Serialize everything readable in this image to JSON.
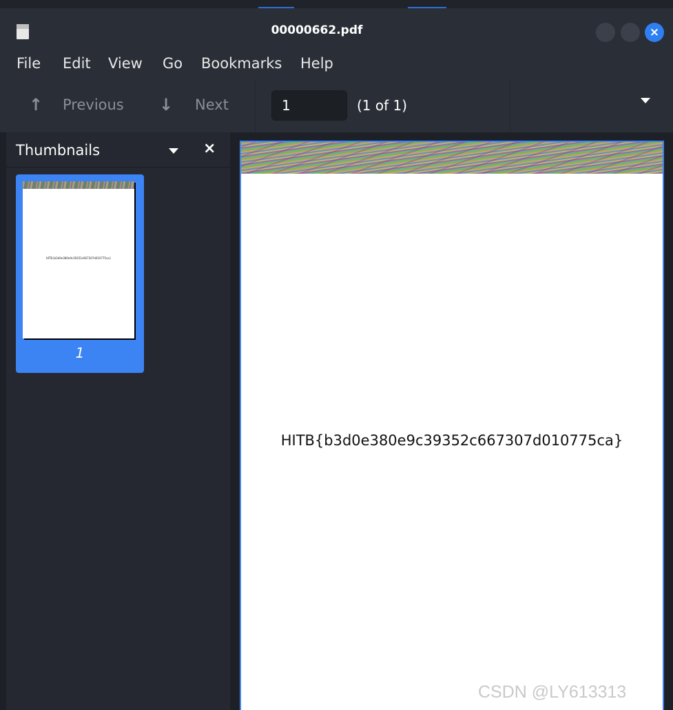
{
  "window": {
    "title": "00000662.pdf",
    "close_glyph": "×"
  },
  "menu": {
    "items": [
      "File",
      "Edit",
      "View",
      "Go",
      "Bookmarks",
      "Help"
    ]
  },
  "toolbar": {
    "previous_label": "Previous",
    "next_label": "Next",
    "page_value": "1",
    "page_count": "(1 of 1)",
    "previous_icon": "arrow-up-icon",
    "next_icon": "arrow-down-icon"
  },
  "sidebar": {
    "title": "Thumbnails",
    "close_glyph": "×",
    "thumbnails": [
      {
        "label": "1",
        "text": "HITB{b3d0e380e9c39352c667307d010775ca}"
      }
    ]
  },
  "document": {
    "text": "HITB{b3d0e380e9c39352c667307d010775ca}"
  },
  "watermark": "CSDN @LY613313",
  "colors": {
    "accent": "#3c83f4",
    "background": "#1d2026",
    "chrome": "#2a2e36"
  }
}
